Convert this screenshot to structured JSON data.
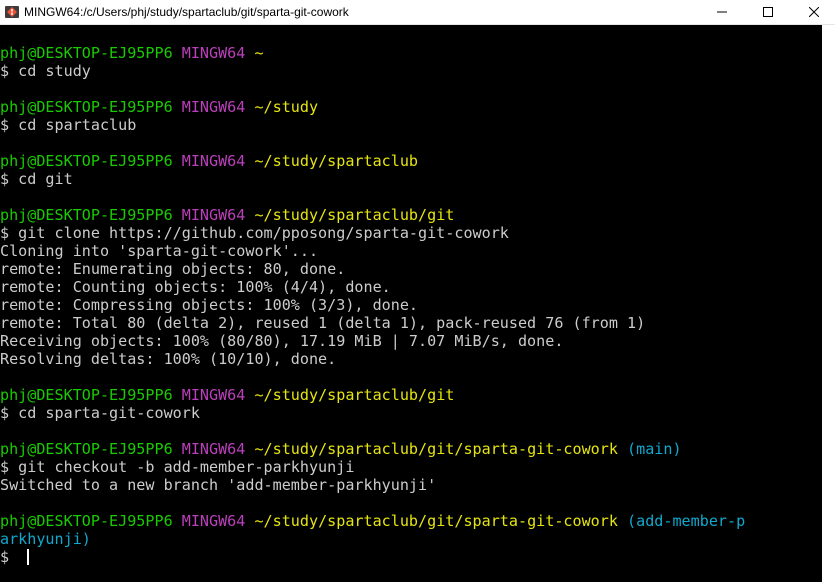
{
  "window": {
    "title": "MINGW64:/c/Users/phj/study/spartaclub/git/sparta-git-cowork",
    "controls": {
      "minimize": "minimize",
      "maximize": "maximize",
      "close": "close"
    }
  },
  "terminal": {
    "lines": [
      {
        "segments": [
          {
            "text": "phj@DESKTOP-EJ95PP6 ",
            "color": "green"
          },
          {
            "text": "MINGW64 ",
            "color": "magenta"
          },
          {
            "text": "~",
            "color": "yellow"
          }
        ]
      },
      {
        "segments": [
          {
            "text": "$ cd study",
            "color": "white"
          }
        ]
      },
      {
        "segments": [
          {
            "text": "",
            "color": "white"
          }
        ]
      },
      {
        "segments": [
          {
            "text": "phj@DESKTOP-EJ95PP6 ",
            "color": "green"
          },
          {
            "text": "MINGW64 ",
            "color": "magenta"
          },
          {
            "text": "~/study",
            "color": "yellow"
          }
        ]
      },
      {
        "segments": [
          {
            "text": "$ cd spartaclub",
            "color": "white"
          }
        ]
      },
      {
        "segments": [
          {
            "text": "",
            "color": "white"
          }
        ]
      },
      {
        "segments": [
          {
            "text": "phj@DESKTOP-EJ95PP6 ",
            "color": "green"
          },
          {
            "text": "MINGW64 ",
            "color": "magenta"
          },
          {
            "text": "~/study/spartaclub",
            "color": "yellow"
          }
        ]
      },
      {
        "segments": [
          {
            "text": "$ cd git",
            "color": "white"
          }
        ]
      },
      {
        "segments": [
          {
            "text": "",
            "color": "white"
          }
        ]
      },
      {
        "segments": [
          {
            "text": "phj@DESKTOP-EJ95PP6 ",
            "color": "green"
          },
          {
            "text": "MINGW64 ",
            "color": "magenta"
          },
          {
            "text": "~/study/spartaclub/git",
            "color": "yellow"
          }
        ]
      },
      {
        "segments": [
          {
            "text": "$ git clone https://github.com/pposong/sparta-git-cowork",
            "color": "white"
          }
        ]
      },
      {
        "segments": [
          {
            "text": "Cloning into 'sparta-git-cowork'...",
            "color": "white"
          }
        ]
      },
      {
        "segments": [
          {
            "text": "remote: Enumerating objects: 80, done.",
            "color": "white"
          }
        ]
      },
      {
        "segments": [
          {
            "text": "remote: Counting objects: 100% (4/4), done.",
            "color": "white"
          }
        ]
      },
      {
        "segments": [
          {
            "text": "remote: Compressing objects: 100% (3/3), done.",
            "color": "white"
          }
        ]
      },
      {
        "segments": [
          {
            "text": "remote: Total 80 (delta 2), reused 1 (delta 1), pack-reused 76 (from 1)",
            "color": "white"
          }
        ]
      },
      {
        "segments": [
          {
            "text": "Receiving objects: 100% (80/80), 17.19 MiB | 7.07 MiB/s, done.",
            "color": "white"
          }
        ]
      },
      {
        "segments": [
          {
            "text": "Resolving deltas: 100% (10/10), done.",
            "color": "white"
          }
        ]
      },
      {
        "segments": [
          {
            "text": "",
            "color": "white"
          }
        ]
      },
      {
        "segments": [
          {
            "text": "phj@DESKTOP-EJ95PP6 ",
            "color": "green"
          },
          {
            "text": "MINGW64 ",
            "color": "magenta"
          },
          {
            "text": "~/study/spartaclub/git",
            "color": "yellow"
          }
        ]
      },
      {
        "segments": [
          {
            "text": "$ cd sparta-git-cowork",
            "color": "white"
          }
        ]
      },
      {
        "segments": [
          {
            "text": "",
            "color": "white"
          }
        ]
      },
      {
        "segments": [
          {
            "text": "phj@DESKTOP-EJ95PP6 ",
            "color": "green"
          },
          {
            "text": "MINGW64 ",
            "color": "magenta"
          },
          {
            "text": "~/study/spartaclub/git/sparta-git-cowork ",
            "color": "yellow"
          },
          {
            "text": "(main)",
            "color": "cyan"
          }
        ]
      },
      {
        "segments": [
          {
            "text": "$ git checkout -b add-member-parkhyunji",
            "color": "white"
          }
        ]
      },
      {
        "segments": [
          {
            "text": "Switched to a new branch 'add-member-parkhyunji'",
            "color": "white"
          }
        ]
      },
      {
        "segments": [
          {
            "text": "",
            "color": "white"
          }
        ]
      },
      {
        "segments": [
          {
            "text": "phj@DESKTOP-EJ95PP6 ",
            "color": "green"
          },
          {
            "text": "MINGW64 ",
            "color": "magenta"
          },
          {
            "text": "~/study/spartaclub/git/sparta-git-cowork ",
            "color": "yellow"
          },
          {
            "text": "(add-member-p",
            "color": "cyan"
          }
        ]
      },
      {
        "segments": [
          {
            "text": "arkhyunji)",
            "color": "cyan"
          }
        ]
      },
      {
        "segments": [
          {
            "text": "$ ",
            "color": "white"
          }
        ],
        "cursor": true
      }
    ],
    "colors": {
      "background": "#000000",
      "text": "#cccccc",
      "green": "#19cb00",
      "magenta": "#bc3fbc",
      "yellow": "#e5e510",
      "cyan": "#11a8cd"
    }
  }
}
